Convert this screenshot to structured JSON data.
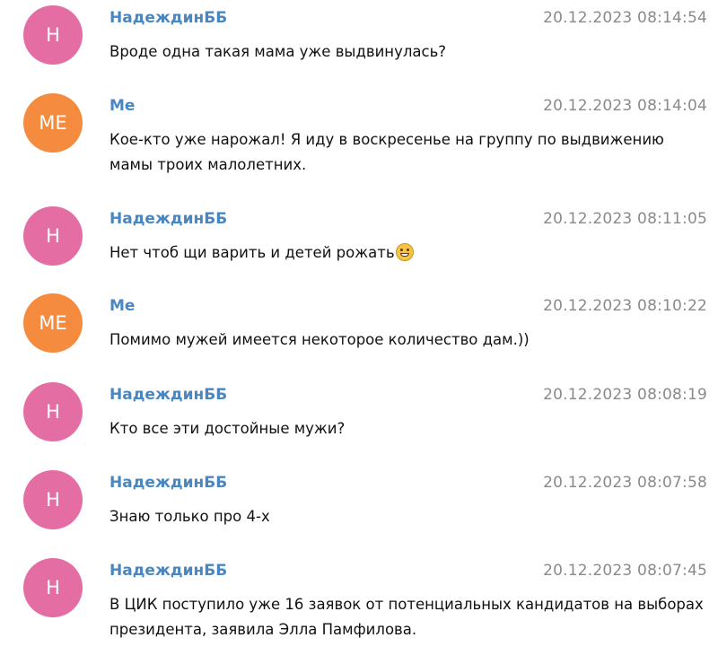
{
  "colors": {
    "avatar_h": "#e46ea4",
    "avatar_me": "#f58b3f",
    "author": "#4a86c0",
    "timestamp": "#8a8a8a",
    "text": "#111111"
  },
  "messages": [
    {
      "avatar": "Н",
      "avatar_color": "#e46ea4",
      "author": "НадеждинББ",
      "time": "20.12.2023 08:14:54",
      "text": "Вроде одна такая мама уже выдвинулась?"
    },
    {
      "avatar": "ME",
      "avatar_color": "#f58b3f",
      "author": "Me",
      "time": "20.12.2023 08:14:04",
      "text": "Кое-кто уже нарожал! Я иду в воскресенье на группу по выдвижению мамы троих малолетних."
    },
    {
      "avatar": "Н",
      "avatar_color": "#e46ea4",
      "author": "НадеждинББ",
      "time": "20.12.2023 08:11:05",
      "text": "Нет чтоб щи варить и детей рожать",
      "emoji": "grinning-face-emoji"
    },
    {
      "avatar": "ME",
      "avatar_color": "#f58b3f",
      "author": "Me",
      "time": "20.12.2023 08:10:22",
      "text": "Помимо мужей имеется некоторое количество дам.))"
    },
    {
      "avatar": "Н",
      "avatar_color": "#e46ea4",
      "author": "НадеждинББ",
      "time": "20.12.2023 08:08:19",
      "text": "Кто все эти достойные мужи?"
    },
    {
      "avatar": "Н",
      "avatar_color": "#e46ea4",
      "author": "НадеждинББ",
      "time": "20.12.2023 08:07:58",
      "text": "Знаю только про 4-х"
    },
    {
      "avatar": "Н",
      "avatar_color": "#e46ea4",
      "author": "НадеждинББ",
      "time": "20.12.2023 08:07:45",
      "text": "В ЦИК поступило уже 16 заявок от потенциальных кандидатов на выборах президента, заявила Элла Памфилова."
    }
  ]
}
